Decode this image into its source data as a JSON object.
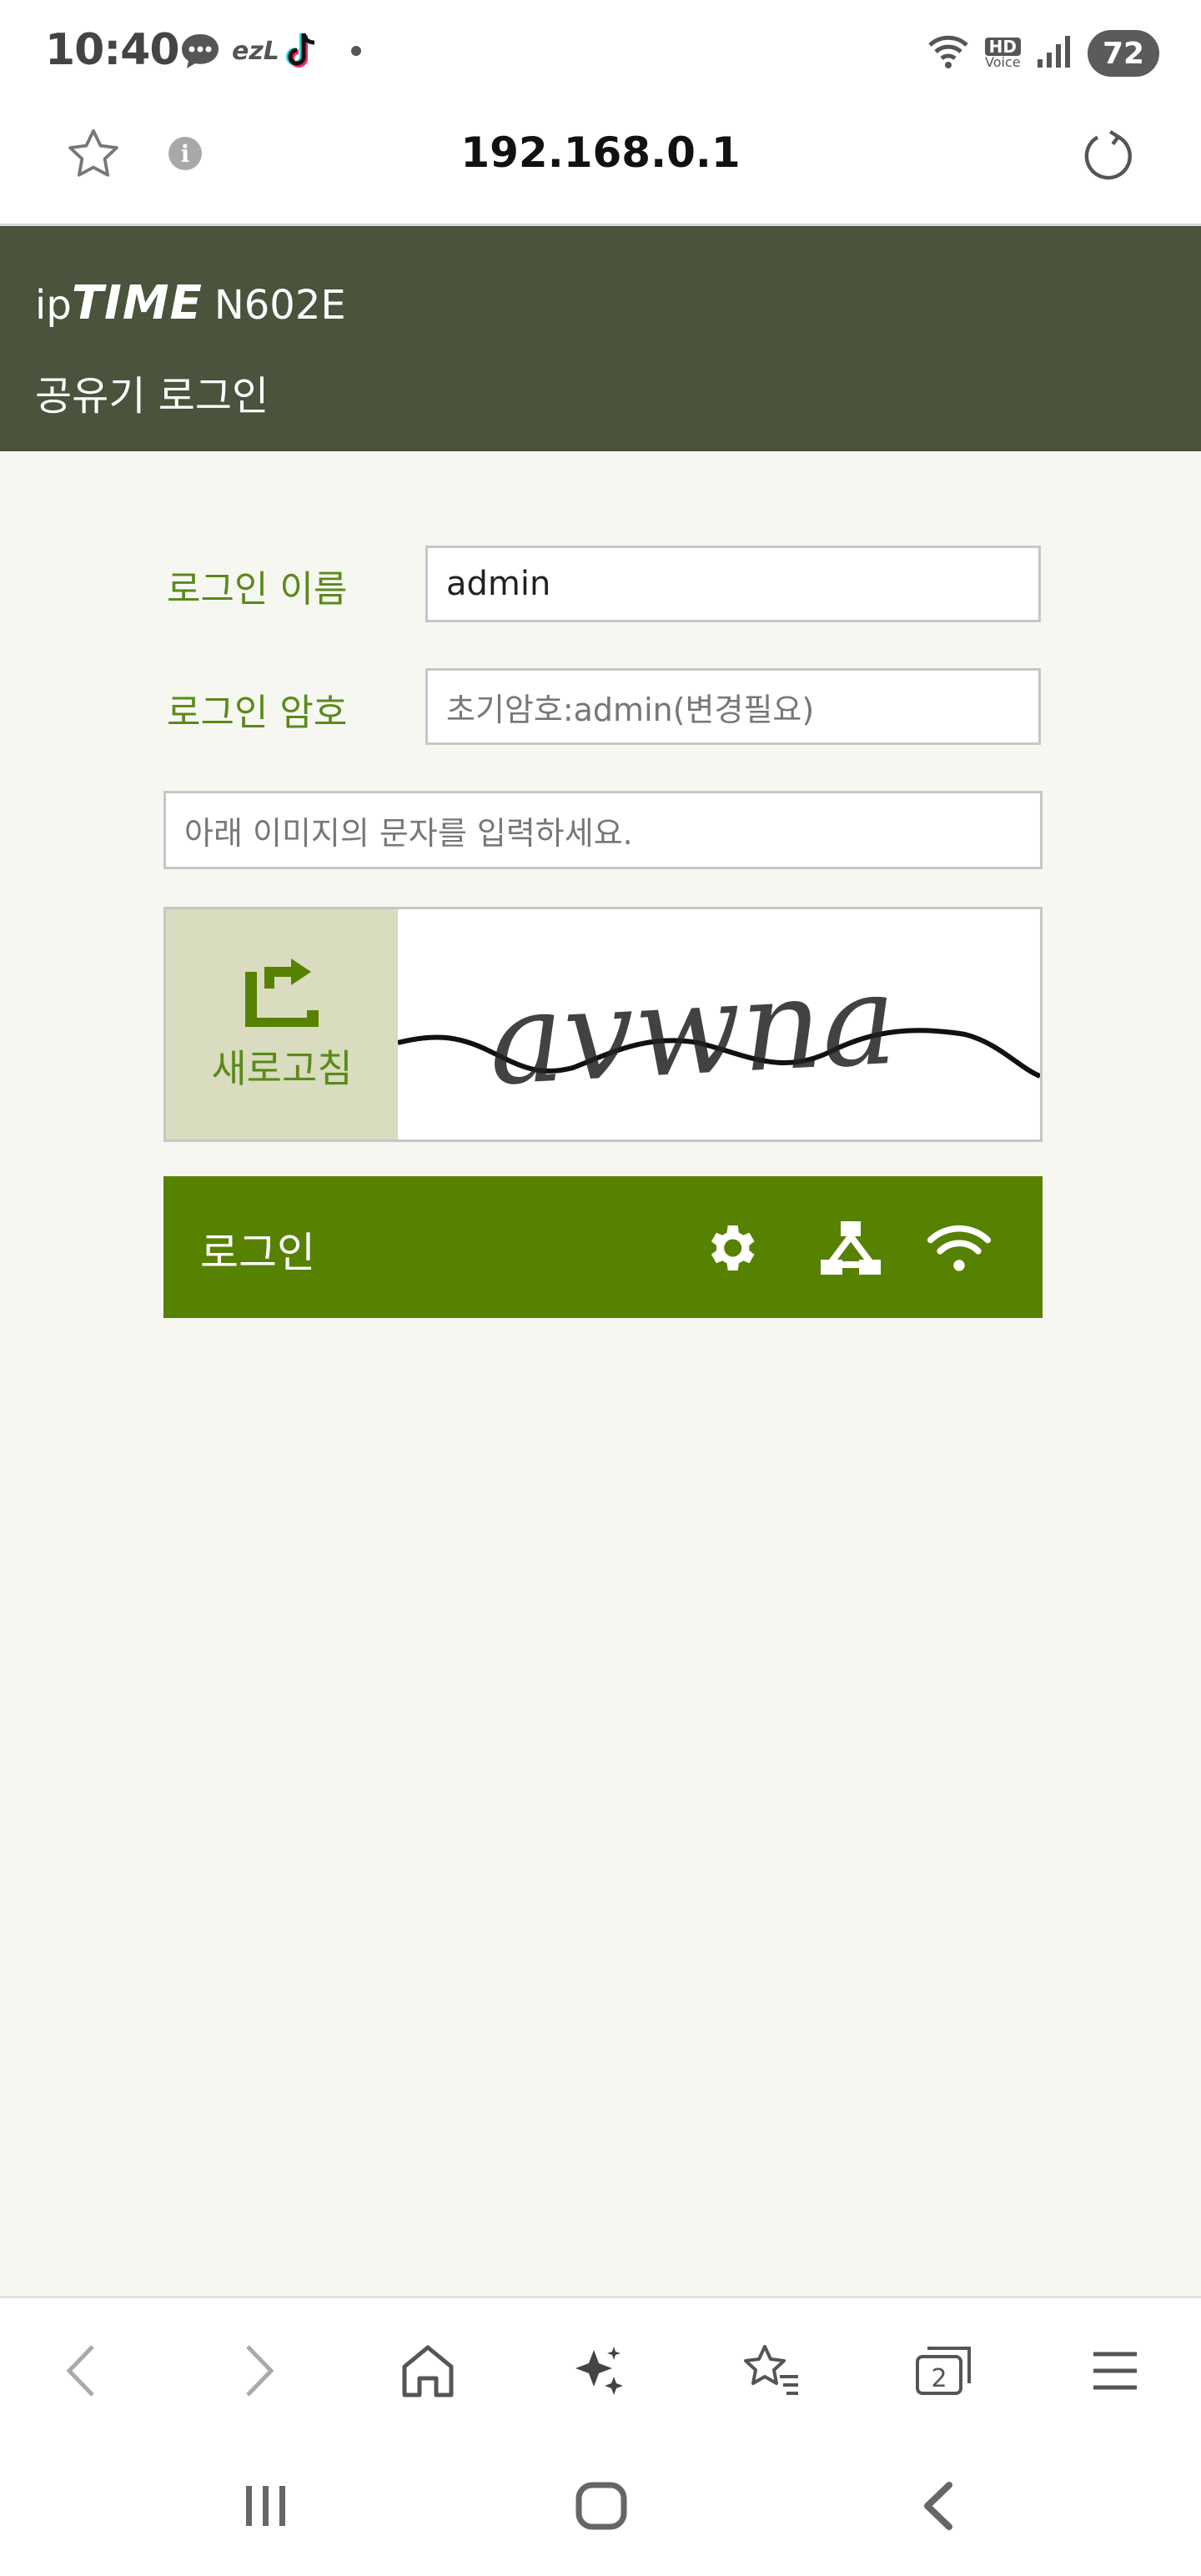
{
  "status_bar": {
    "time": "10:40",
    "notif_ezl": "ezL",
    "battery": "72",
    "hd_label": "HD",
    "voice_label": "Voice"
  },
  "browser": {
    "url": "192.168.0.1",
    "info_glyph": "i"
  },
  "header": {
    "brand_ip": "ip",
    "brand_time": "TIME",
    "model": "N602E",
    "subtitle": "공유기 로그인"
  },
  "login_form": {
    "username_label": "로그인 이름",
    "username_value": "admin",
    "password_label": "로그인 암호",
    "password_placeholder": "초기암호:admin(변경필요)",
    "captcha_placeholder": "아래 이미지의 문자를 입력하세요.",
    "refresh_label": "새로고침",
    "captcha_text": "avwna",
    "login_button": "로그인"
  },
  "bottom_nav": {
    "tabs_count": "2"
  },
  "colors": {
    "header_bg": "#4a533b",
    "accent_green": "#578100",
    "label_green": "#5a8a1a",
    "page_bg": "#f7f7f2",
    "refresh_bg": "#d9dcbf"
  },
  "icons": [
    "star-icon",
    "info-icon",
    "reload-icon",
    "refresh-icon",
    "gear-icon",
    "network-icon",
    "wifi-icon",
    "back-icon",
    "forward-icon",
    "home-icon",
    "sparkle-icon",
    "bookmarks-icon",
    "tabs-icon",
    "menu-icon"
  ]
}
